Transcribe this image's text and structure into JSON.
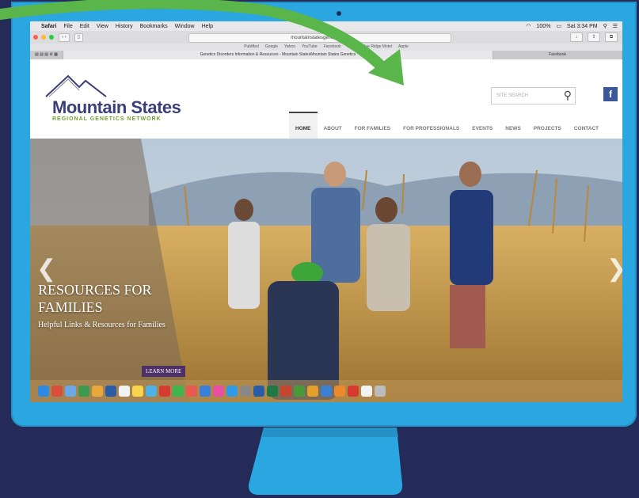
{
  "menubar": {
    "app": "Safari",
    "items": [
      "File",
      "Edit",
      "View",
      "History",
      "Bookmarks",
      "Window",
      "Help"
    ],
    "battery": "100%",
    "clock": "Sat 3:34 PM"
  },
  "browser": {
    "url": "mountainstatesgenetics.org",
    "favorites": [
      "PubMed",
      "Google",
      "Yahoo",
      "YouTube",
      "Facebook",
      "Print",
      "Blue Ridge Motel",
      "Apple"
    ],
    "tabs": [
      {
        "label": "Genetics Disorders Information & Resources - Mountain StatesMountain States Genetics"
      },
      {
        "label": "Facebook"
      }
    ]
  },
  "site": {
    "logo_title": "Mountain States",
    "logo_sub": "REGIONAL GENETICS NETWORK",
    "search_placeholder": "SITE SEARCH",
    "facebook_label": "f",
    "nav": [
      "HOME",
      "ABOUT",
      "FOR FAMILIES",
      "FOR PROFESSIONALS",
      "EVENTS",
      "NEWS",
      "PROJECTS",
      "CONTACT"
    ]
  },
  "hero": {
    "title": "RESOURCES FOR FAMILIES",
    "subtitle": "Helpful Links & Resources for Families",
    "cta": "LEARN MORE"
  },
  "colors": {
    "bezel": "#2aa7e0",
    "background": "#242b58",
    "arrow": "#5ab54a",
    "brand_purple": "#4c3066",
    "brand_green": "#6fa230"
  },
  "icons": {
    "apple": "apple-icon",
    "search": "search-icon",
    "facebook": "facebook-icon",
    "prev": "chevron-left-icon",
    "next": "chevron-right-icon"
  }
}
